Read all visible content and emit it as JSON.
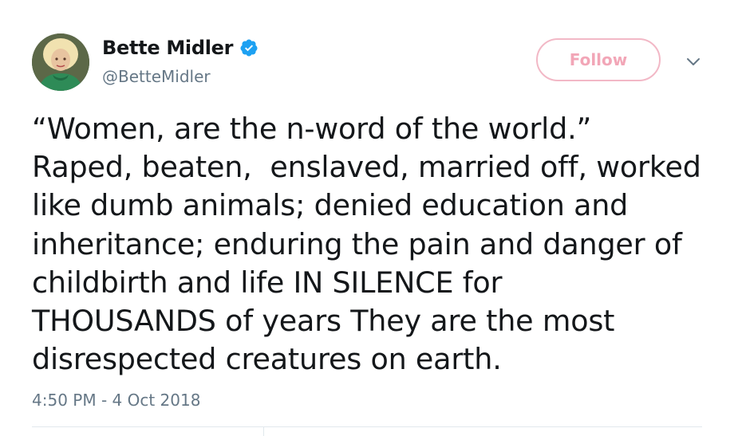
{
  "user": {
    "display_name": "Bette Midler",
    "handle": "@BetteMidler",
    "verified": true,
    "avatar_icon": "profile-photo"
  },
  "actions": {
    "follow_label": "Follow",
    "menu_icon": "chevron-down-icon"
  },
  "tweet": {
    "text": "“Women, are the n-word of the world.”\nRaped, beaten,  enslaved, married off, worked\nlike dumb animals; denied education and\ninheritance; enduring the pain and danger of\nchildbirth and life IN SILENCE for\nTHOUSANDS of years They are the most\ndisrespected creatures on earth.",
    "timestamp": "4:50 PM - 4 Oct 2018"
  },
  "colors": {
    "text": "#14171a",
    "secondary": "#657786",
    "verified_blue": "#1da1f2",
    "follow_border": "#f2b8c6",
    "follow_text": "#f2a6b7",
    "divider": "#e1e8ed"
  }
}
